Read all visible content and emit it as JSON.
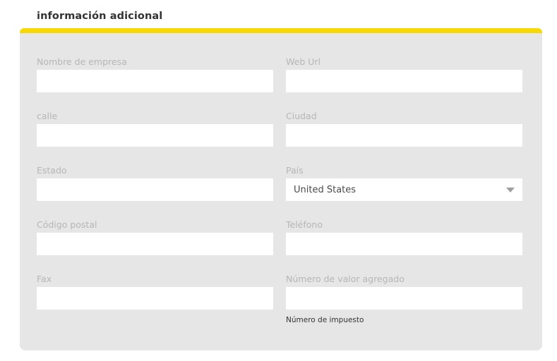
{
  "page": {
    "title": "información adicional",
    "accent_color": "#f7d800",
    "panel_background": "#e6e6e6"
  },
  "form": {
    "rows": [
      {
        "left": {
          "label": "Nombre de empresa",
          "value": "",
          "placeholder": "",
          "type": "text"
        },
        "right": {
          "label": "Web Url",
          "value": "",
          "placeholder": "",
          "type": "text"
        }
      },
      {
        "left": {
          "label": "calle",
          "value": "",
          "placeholder": "",
          "type": "text"
        },
        "right": {
          "label": "Ciudad",
          "value": "",
          "placeholder": "",
          "type": "text"
        }
      },
      {
        "left": {
          "label": "Estado",
          "value": "",
          "placeholder": "",
          "type": "text"
        },
        "right": {
          "label": "País",
          "value": "United States",
          "type": "select",
          "icon": "chevron-down-icon",
          "options": [
            "United States"
          ]
        }
      },
      {
        "left": {
          "label": "Código postal",
          "value": "",
          "placeholder": "",
          "type": "text"
        },
        "right": {
          "label": "Teléfono",
          "value": "",
          "placeholder": "",
          "type": "text"
        }
      },
      {
        "left": {
          "label": "Fax",
          "value": "",
          "placeholder": "",
          "type": "text"
        },
        "right": {
          "label": "Número de valor agregado",
          "value": "",
          "placeholder": "",
          "type": "text",
          "help": "Número de impuesto"
        }
      }
    ]
  }
}
